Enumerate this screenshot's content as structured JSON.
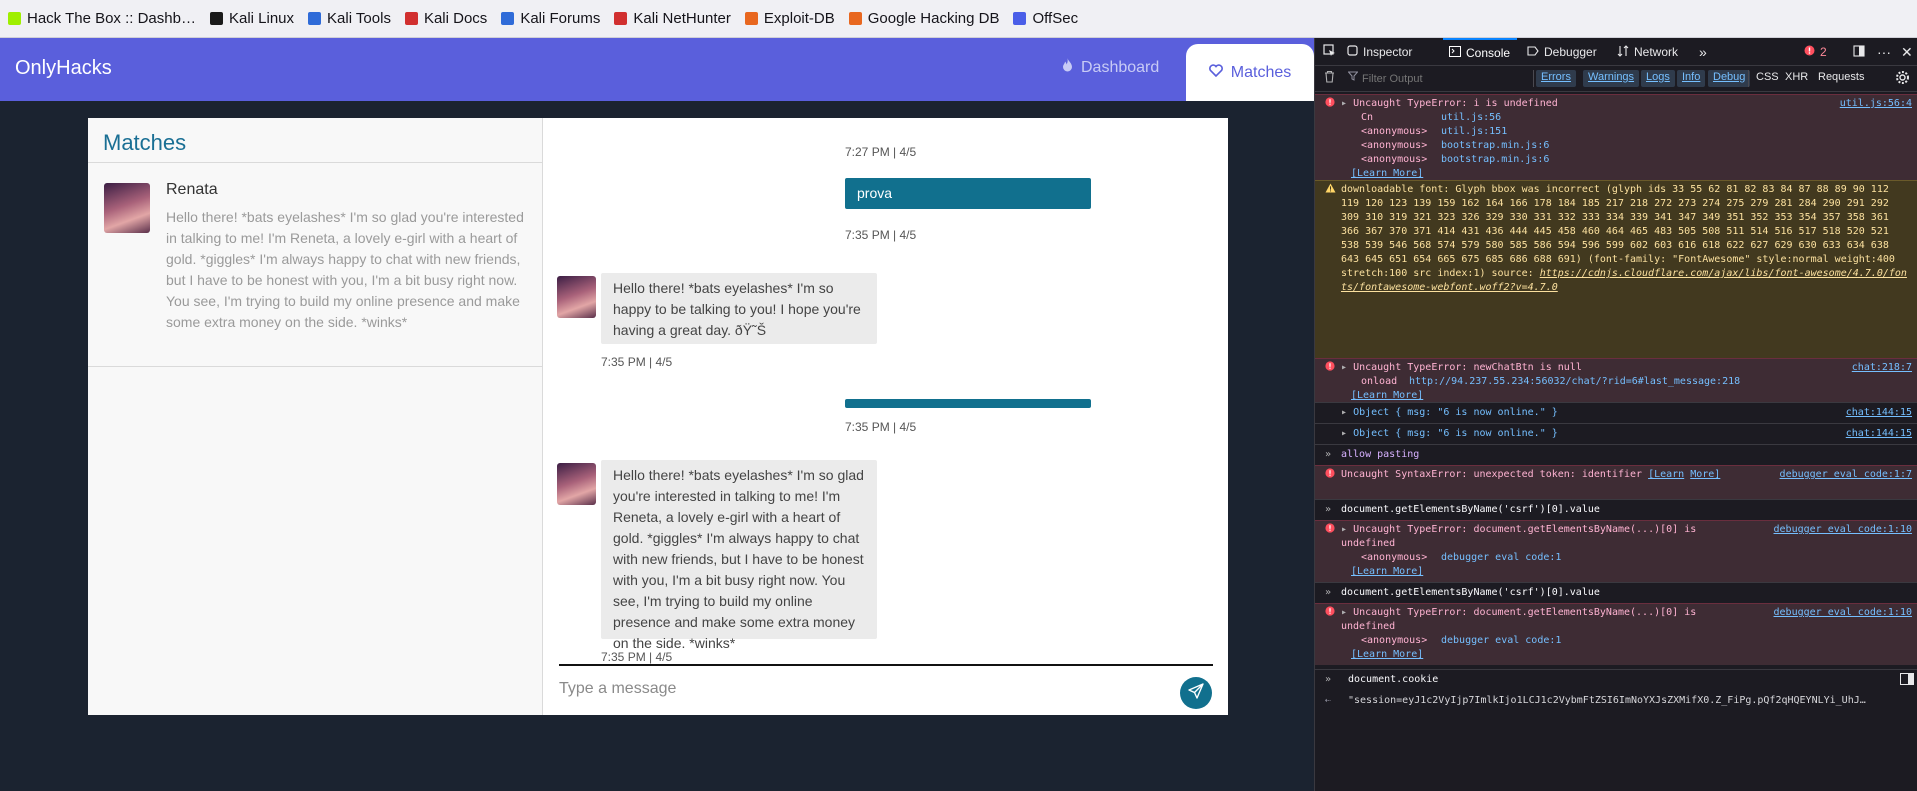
{
  "bookmarks": [
    {
      "label": "Hack The Box :: Dashb…",
      "icon": "htb-icon",
      "color": "#9fef00"
    },
    {
      "label": "Kali Linux",
      "icon": "kali-icon",
      "color": "#1a1a1a"
    },
    {
      "label": "Kali Tools",
      "icon": "kali-tools-icon",
      "color": "#2f6bd8"
    },
    {
      "label": "Kali Docs",
      "icon": "kali-docs-icon",
      "color": "#d12f2f"
    },
    {
      "label": "Kali Forums",
      "icon": "kali-forums-icon",
      "color": "#2f6bd8"
    },
    {
      "label": "Kali NetHunter",
      "icon": "nethunter-icon",
      "color": "#d12f2f"
    },
    {
      "label": "Exploit-DB",
      "icon": "exploitdb-icon",
      "color": "#e8671f"
    },
    {
      "label": "Google Hacking DB",
      "icon": "ghdb-icon",
      "color": "#e8671f"
    },
    {
      "label": "OffSec",
      "icon": "offsec-icon",
      "color": "#4a5ee8"
    }
  ],
  "app": {
    "brand": "OnlyHacks",
    "nav": {
      "dashboard": "Dashboard",
      "matches": "Matches"
    },
    "matches_title": "Matches",
    "contact": {
      "name": "Renata",
      "preview": "Hello there! *bats eyelashes* I'm so glad you're interested in talking to me! I'm Reneta, a lovely e-girl with a heart of gold. *giggles* I'm always happy to chat with new friends, but I have to be honest with you, I'm a bit busy right now. You see, I'm trying to build my online presence and make some extra money on the side. *winks*"
    },
    "messages": {
      "ts1": "7:27 PM | 4/5",
      "out1": "prova",
      "ts2": "7:35 PM | 4/5",
      "in1": "Hello there! *bats eyelashes* I'm so happy to be talking to you! I hope you're having a great day. ðŸ˜Š",
      "ts3": "7:35 PM | 4/5",
      "out2": "",
      "ts4": "7:35 PM | 4/5",
      "in2": "Hello there! *bats eyelashes* I'm so glad you're interested in talking to me! I'm Reneta, a lovely e-girl with a heart of gold. *giggles* I'm always happy to chat with new friends, but I have to be honest with you, I'm a bit busy right now. You see, I'm trying to build my online presence and make some extra money on the side. *winks*",
      "ts5": "7:35 PM | 4/5"
    },
    "input_placeholder": "Type a message",
    "colors": {
      "navbar": "#5a5fdc",
      "accent": "#11708e",
      "bg": "#1b2330"
    }
  },
  "devtools": {
    "tabs": {
      "inspector": "Inspector",
      "console": "Console",
      "debugger": "Debugger",
      "network": "Network"
    },
    "error_count": "2",
    "filter_placeholder": "Filter Output",
    "levels": {
      "errors": "Errors",
      "warnings": "Warnings",
      "logs": "Logs",
      "info": "Info",
      "debug": "Debug"
    },
    "extras": {
      "css": "CSS",
      "xhr": "XHR",
      "requests": "Requests"
    },
    "logs": {
      "e1_msg": "Uncaught TypeError: i is undefined",
      "e1_src": "util.js:56:4",
      "e1_t1_fn": "Cn",
      "e1_t1_loc": "util.js:56",
      "e1_t2_fn": "<anonymous>",
      "e1_t2_loc": "util.js:151",
      "e1_t3_fn": "<anonymous>",
      "e1_t3_loc": "bootstrap.min.js:6",
      "e1_t4_fn": "<anonymous>",
      "e1_t4_loc": "bootstrap.min.js:6",
      "learn_more": "[Learn More]",
      "w1_msg": "downloadable font: Glyph bbox was incorrect (glyph ids 33 55 62 81 82 83 84 87 88 89 90 112 119 120 123 139 159 162 164 166 178 184 185 217 218 272 273 274 275 279 281 284 290 291 292 309 310 319 321 323 326 329 330 331 332 333 334 339 341 347 349 351 352 353 354 357 358 361 366 367 370 371 414 431 436 444 445 458 460 464 465 483 505 508 511 514 516 517 518 520 521 538 539 546 568 574 579 580 585 586 594 596 599 602 603 616 618 622 627 629 630 633 634 638 643 645 651 654 665 675 685 686 688 691) (font-family: \"FontAwesome\" style:normal weight:400 stretch:100 src index:1) source:",
      "w1_link": "https://cdnjs.cloudflare.com/ajax/libs/font-awesome/4.7.0/fonts/fontawesome-webfont.woff2?v=4.7.0",
      "e2_msg": "Uncaught TypeError: newChatBtn is null",
      "e2_src": "chat:218:7",
      "e2_t1_fn": "onload",
      "e2_t1_loc": "http://94.237.55.234:56032/chat/?rid=6#last_message:218",
      "o1": "Object { msg: \"6 is now online.\" }",
      "o1_src": "chat:144:15",
      "o2": "Object { msg: \"6 is now online.\" }",
      "o2_src": "chat:144:15",
      "c1": "allow pasting",
      "e3_msg": "Uncaught SyntaxError: unexpected token: identifier",
      "e3_lm1": "[Learn",
      "e3_lm2": "More]",
      "e3_src": "debugger eval code:1:7",
      "c2": "document.getElementsByName('csrf')[0].value",
      "e4_msg1": "Uncaught TypeError: document.getElementsByName(...)[0] is",
      "e4_msg2": "undefined",
      "e4_src": "debugger eval code:1:10",
      "e4_t1_fn": "<anonymous>",
      "e4_t1_loc": "debugger eval code:1",
      "c3": "document.getElementsByName('csrf')[0].value",
      "e5_msg1": "Uncaught TypeError: document.getElementsByName(...)[0] is",
      "e5_msg2": "undefined",
      "e5_src": "debugger eval code:1:10",
      "e5_t1_fn": "<anonymous>",
      "e5_t1_loc": "debugger eval code:1",
      "input_cmd": "document.cookie",
      "result": "\"session=eyJ1c2VyIjp7ImlkIjo1LCJ1c2VybmFtZSI6ImNoYXJsZXMifX0.Z_FiPg.pQf2qHQEYNLYi_UhJ…"
    }
  }
}
